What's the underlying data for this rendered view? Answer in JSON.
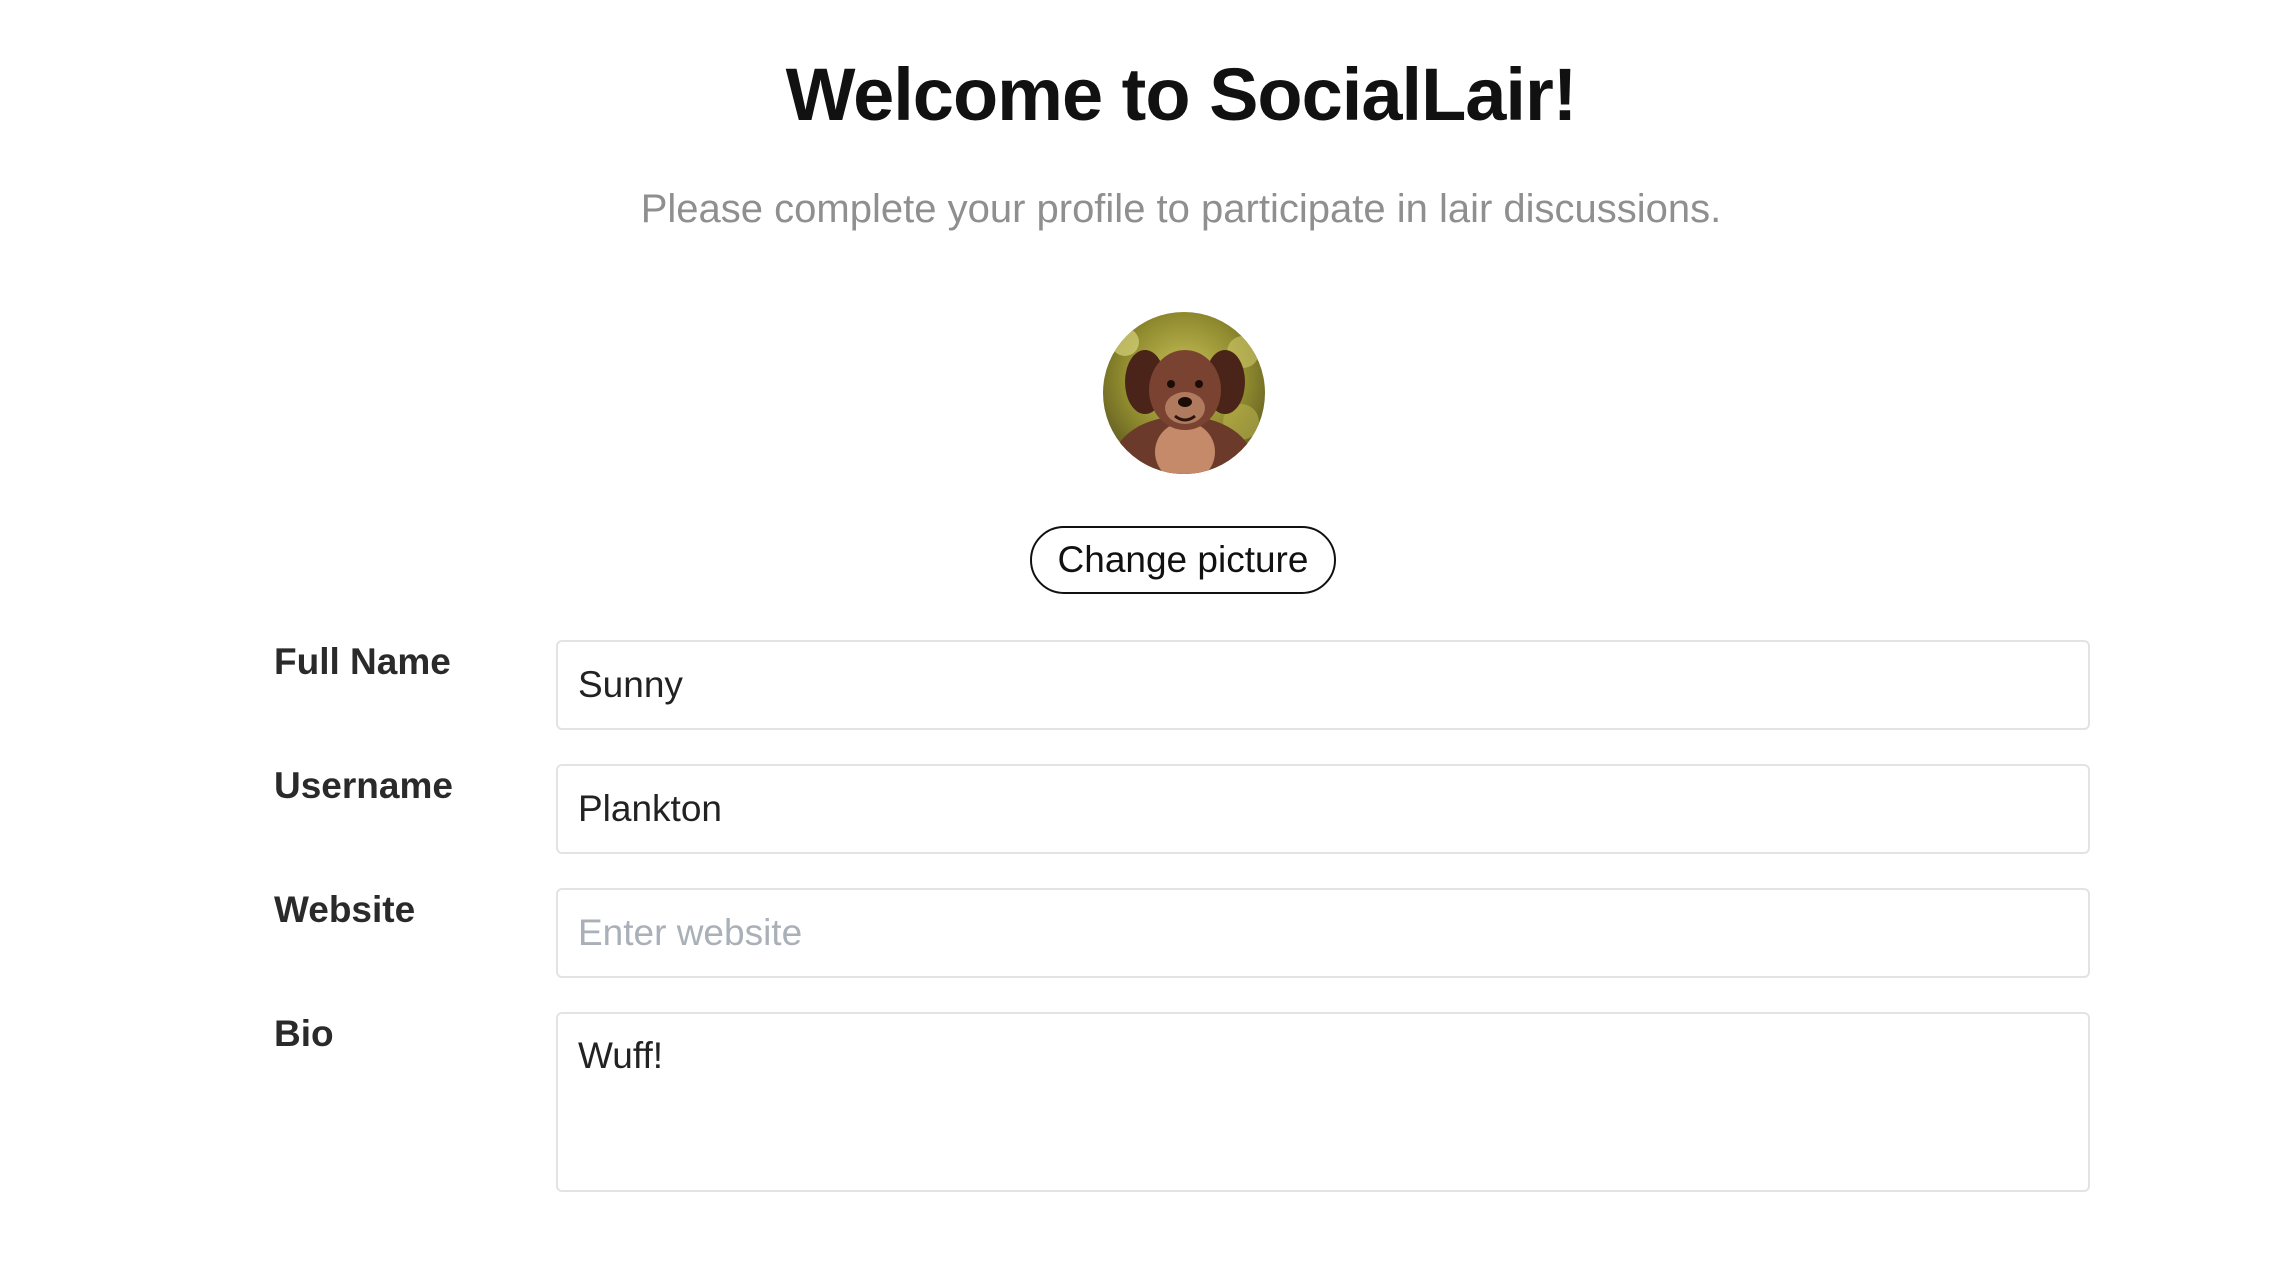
{
  "header": {
    "title": "Welcome to SocialLair!",
    "subtitle": "Please complete your profile to participate in lair discussions."
  },
  "profile": {
    "avatar_alt": "dog photo avatar",
    "change_picture_label": "Change picture"
  },
  "form": {
    "full_name": {
      "label": "Full Name",
      "value": "Sunny",
      "placeholder": ""
    },
    "username": {
      "label": "Username",
      "value": "Plankton",
      "placeholder": ""
    },
    "website": {
      "label": "Website",
      "value": "",
      "placeholder": "Enter website"
    },
    "bio": {
      "label": "Bio",
      "value": "Wuff!",
      "placeholder": ""
    }
  },
  "colors": {
    "title": "#111111",
    "subtitle": "#8f8f8f",
    "field_border": "#e3e3e3",
    "placeholder": "#a9b0b8"
  }
}
